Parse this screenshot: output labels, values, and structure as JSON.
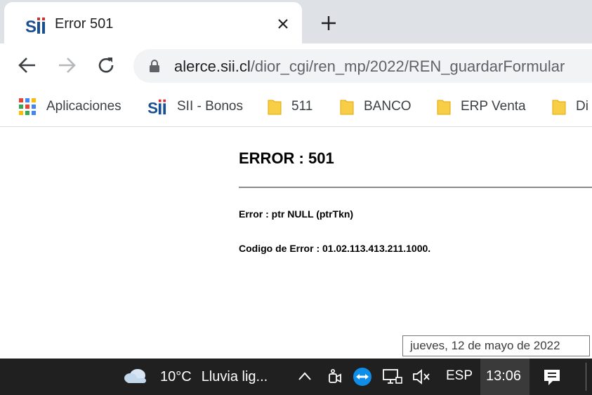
{
  "tab": {
    "title": "Error 501"
  },
  "address_bar": {
    "host": "alerce.sii.cl",
    "path": "/dior_cgi/ren_mp/2022/REN_guardarFormular"
  },
  "bookmarks": [
    {
      "label": "Aplicaciones",
      "icon": "apps-grid-icon"
    },
    {
      "label": "SII - Bonos",
      "icon": "sii-logo-icon"
    },
    {
      "label": "511",
      "icon": "folder-icon"
    },
    {
      "label": "BANCO",
      "icon": "folder-icon"
    },
    {
      "label": "ERP Venta",
      "icon": "folder-icon"
    },
    {
      "label": "Di",
      "icon": "folder-icon"
    }
  ],
  "error_page": {
    "title": "ERROR : 501",
    "message": "Error : ptr NULL (ptrTkn)",
    "code": "Codigo de Error : 01.02.113.413.211.1000."
  },
  "tooltip": {
    "text": "jueves, 12 de mayo de 2022"
  },
  "taskbar": {
    "weather_temp": "10°C",
    "weather_desc": "Lluvia lig...",
    "language": "ESP",
    "time": "13:06"
  },
  "colors": {
    "tabstrip_bg": "#dee1e6",
    "folder_yellow": "#f7ce46",
    "taskbar_bg": "#202020"
  }
}
